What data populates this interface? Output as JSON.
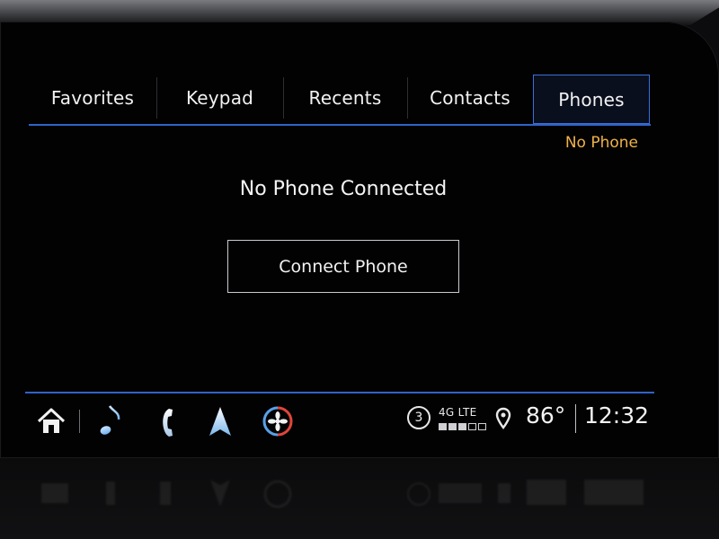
{
  "tabs": [
    {
      "label": "Favorites",
      "active": false
    },
    {
      "label": "Keypad",
      "active": false
    },
    {
      "label": "Recents",
      "active": false
    },
    {
      "label": "Contacts",
      "active": false
    },
    {
      "label": "Phones",
      "active": true
    }
  ],
  "status": {
    "phone_state": "No Phone"
  },
  "main": {
    "headline": "No Phone Connected",
    "connect_button_label": "Connect Phone"
  },
  "bottom_bar": {
    "icons": [
      "home-icon",
      "music-note-icon",
      "phone-icon",
      "navigation-arrow-icon",
      "climate-fan-icon"
    ],
    "notification_count": "3",
    "network": "4G LTE",
    "signal_bars_filled": 3,
    "signal_bars_total": 5,
    "temperature": "86°",
    "time": "12:32"
  },
  "colors": {
    "accent_blue": "#2f63c8",
    "status_orange": "#f0b24a",
    "climate_red": "#e0453a",
    "climate_blue": "#5aa0e6",
    "nav_blue": "#8cc3f2",
    "text": "#f2f2f2"
  }
}
